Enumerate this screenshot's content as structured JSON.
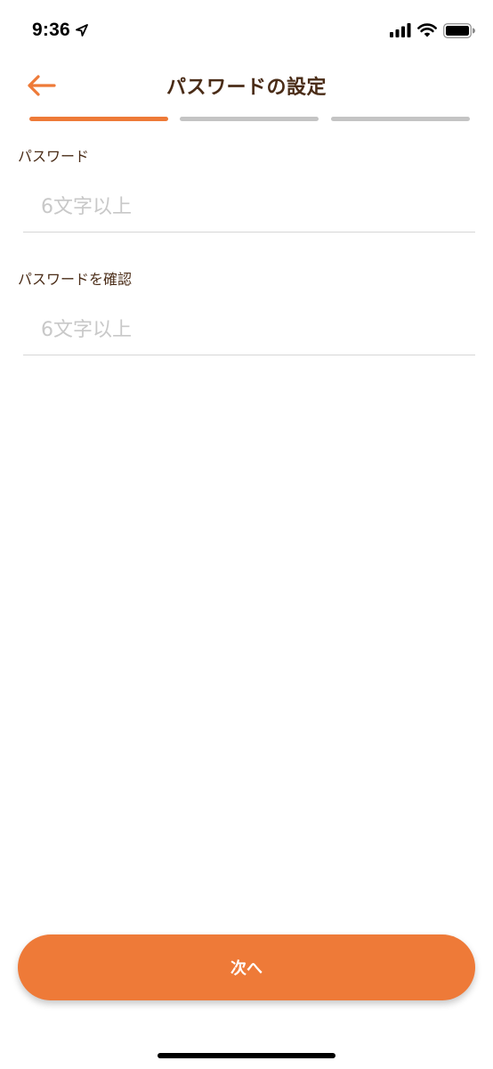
{
  "status_bar": {
    "time": "9:36",
    "location_icon": "location-arrow-icon",
    "signal_icon": "cellular-signal-icon",
    "wifi_icon": "wifi-icon",
    "battery_icon": "battery-icon"
  },
  "header": {
    "title": "パスワードの設定",
    "back_icon": "arrow-left-icon"
  },
  "steps": [
    {
      "state": "active",
      "color": "#ee7a38"
    },
    {
      "state": "inactive",
      "color": "#c4c4c4"
    },
    {
      "state": "inactive",
      "color": "#c4c4c4"
    }
  ],
  "form": {
    "password_label": "パスワード",
    "password_value": "",
    "password_placeholder": "6文字以上",
    "confirm_label": "パスワードを確認",
    "confirm_value": "",
    "confirm_placeholder": "6文字以上"
  },
  "next_button": {
    "label": "次へ"
  },
  "colors": {
    "accent": "#ee7a38",
    "title": "#4a2c17",
    "inactive_step": "#c4c4c4",
    "placeholder": "#c8c8c8"
  }
}
